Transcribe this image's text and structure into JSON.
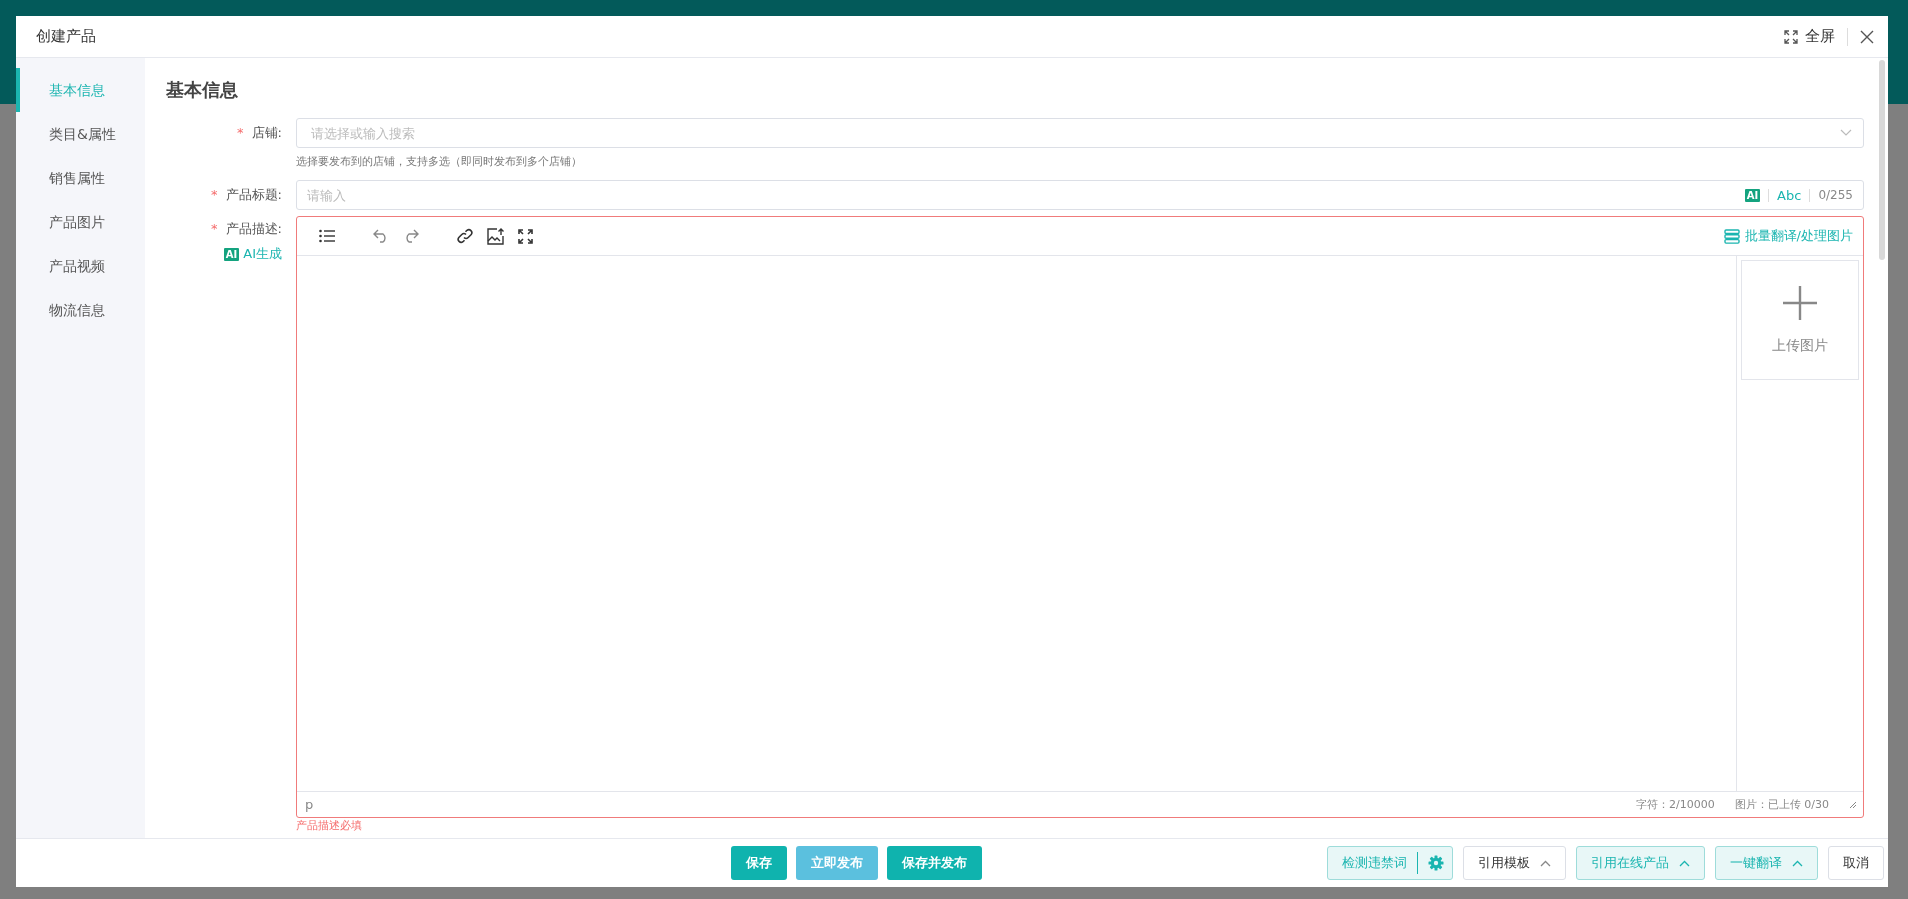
{
  "dialog": {
    "title": "创建产品",
    "fullscreen_label": "全屏"
  },
  "nav": [
    {
      "label": "基本信息",
      "selected": true
    },
    {
      "label": "类目&属性",
      "selected": false
    },
    {
      "label": "销售属性",
      "selected": false
    },
    {
      "label": "产品图片",
      "selected": false
    },
    {
      "label": "产品视频",
      "selected": false
    },
    {
      "label": "物流信息",
      "selected": false
    }
  ],
  "section_title": "基本信息",
  "store": {
    "mark": "*",
    "label": "店铺:",
    "placeholder": "请选择或输入搜索",
    "hint": "选择要发布到的店铺，支持多选（即同时发布到多个店铺）"
  },
  "title": {
    "mark": "*",
    "label": "产品标题:",
    "placeholder": "请输入",
    "ai_badge": "AI",
    "abc": "Abc",
    "counter": "0/255"
  },
  "description": {
    "mark": "*",
    "label": "产品描述:",
    "ai_badge": "AI",
    "ai_label": "AI生成",
    "batch_label": "批量翻译/处理图片",
    "upload_label": "上传图片",
    "path": "p",
    "char_count": "字符：2/10000",
    "image_count": "图片：已上传 0/30",
    "invalid": true,
    "error": "产品描述必填"
  },
  "footer_left": [
    {
      "label": "保存",
      "kind": "primary"
    },
    {
      "label": "立即发布",
      "kind": "light"
    },
    {
      "label": "保存并发布",
      "kind": "primary"
    }
  ],
  "footer_right": [
    {
      "label": "检测违禁词",
      "kind": "split"
    },
    {
      "label": "引用模板",
      "kind": "plain-dropdown"
    },
    {
      "label": "引用在线产品",
      "kind": "tinted-dropdown"
    },
    {
      "label": "一键翻译",
      "kind": "tinted-dropdown"
    },
    {
      "label": "取消",
      "kind": "plain"
    }
  ]
}
